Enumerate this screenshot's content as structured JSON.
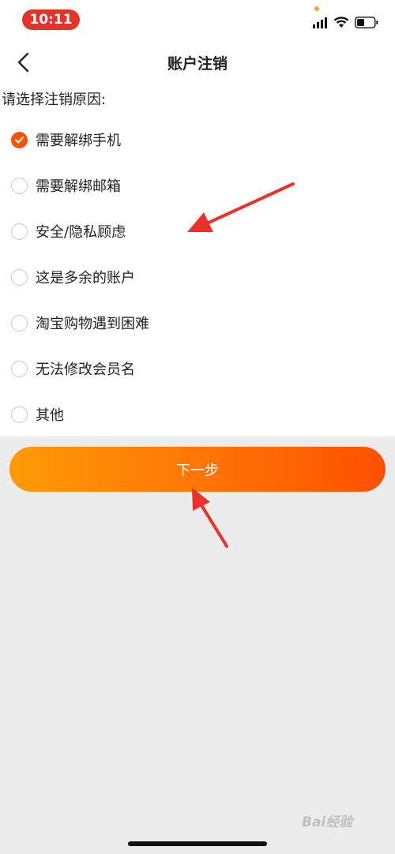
{
  "status_bar": {
    "time": "10:11",
    "time_pill_color": "#e0352b",
    "icons": [
      "signal-icon",
      "wifi-icon",
      "battery-icon"
    ]
  },
  "header": {
    "title": "账户注销",
    "back_icon": "chevron-left-icon"
  },
  "form": {
    "prompt": "请选择注销原因:",
    "options": [
      {
        "label": "需要解绑手机",
        "checked": true
      },
      {
        "label": "需要解绑邮箱",
        "checked": false
      },
      {
        "label": "安全/隐私顾虑",
        "checked": false
      },
      {
        "label": "这是多余的账户",
        "checked": false
      },
      {
        "label": "淘宝购物遇到困难",
        "checked": false
      },
      {
        "label": "无法修改会员名",
        "checked": false
      },
      {
        "label": "其他",
        "checked": false
      }
    ]
  },
  "next_button": {
    "label": "下一步",
    "gradient": [
      "#ff9a05",
      "#ff5000"
    ]
  },
  "accent_color": "#ff5000",
  "annotation_color": "#e8322b",
  "watermark": "Bai经验"
}
